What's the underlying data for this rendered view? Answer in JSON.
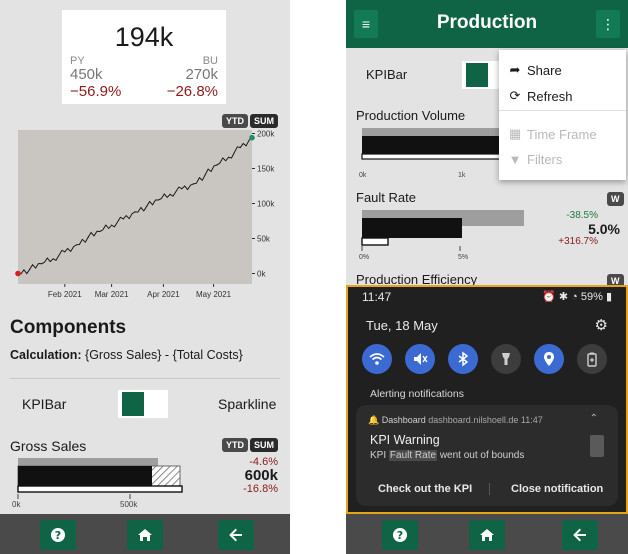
{
  "left_screen": {
    "kpi": {
      "value": "194k",
      "py_label": "PY",
      "bu_label": "BU",
      "py_value": "450k",
      "bu_value": "270k",
      "py_delta": "−56.9%",
      "bu_delta": "−26.8%"
    },
    "toggles": {
      "ytd": "YTD",
      "sum": "SUM"
    },
    "chart_data": {
      "type": "line",
      "x": [
        "2021-01-04",
        "2021-01-11",
        "2021-01-18",
        "2021-01-25",
        "2021-02-01",
        "2021-02-08",
        "2021-02-15",
        "2021-02-22",
        "2021-03-01",
        "2021-03-08",
        "2021-03-15",
        "2021-03-22",
        "2021-03-29",
        "2021-04-05",
        "2021-04-12",
        "2021-04-19",
        "2021-04-26",
        "2021-05-03",
        "2021-05-10",
        "2021-05-17",
        "2021-05-24"
      ],
      "values": [
        0,
        6,
        14,
        21,
        31,
        41,
        52,
        60,
        69,
        78,
        88,
        96,
        105,
        113,
        121,
        128,
        141,
        155,
        166,
        180,
        194
      ],
      "x_ticks": [
        "Feb 2021",
        "Mar 2021",
        "Apr 2021",
        "May 2021"
      ],
      "y_ticks": [
        "200k",
        "150k",
        "100k",
        "50k",
        "0k"
      ],
      "ylim": [
        -15,
        205
      ],
      "start_marker_color": "#d62020",
      "end_marker_color": "#1f8f6a",
      "line_color": "#1a1a1a",
      "background_color": "#c9c6c2"
    },
    "components_title": "Components",
    "calculation_label": "Calculation:",
    "calculation_text": "{Gross Sales} - {Total Costs}",
    "kpibar_label": "KPIBar",
    "sparkline_label": "Sparkline",
    "gross_sales": {
      "label": "Gross Sales",
      "pct_top": "-4.6%",
      "value": "600k",
      "pct_bottom": "-16.8%",
      "axis": [
        "0k",
        "500k"
      ]
    },
    "nav": [
      "help-icon",
      "home-icon",
      "back-icon"
    ]
  },
  "right_screen": {
    "title": "Production",
    "kpibar_label": "KPIBar",
    "menu": {
      "share": "Share",
      "refresh": "Refresh",
      "time_frame": "Time Frame",
      "filters": "Filters"
    },
    "production_volume": {
      "label": "Production Volume",
      "axis": [
        "0k",
        "1k"
      ]
    },
    "fault_rate": {
      "label": "Fault Rate",
      "badge": "W",
      "pct_top": "-38.5%",
      "value": "5.0%",
      "pct_bottom": "+316.7%",
      "axis": [
        "0%",
        "5%"
      ]
    },
    "production_efficiency": {
      "label": "Production Efficiency",
      "badge": "W"
    },
    "shade": {
      "time": "11:47",
      "status_right": "59%",
      "date": "Tue, 18 May",
      "alert_header": "Alerting notifications",
      "notif_app": "Dashboard",
      "notif_source": "dashboard.nilshoell.de",
      "notif_time": "11:47",
      "notif_title": "KPI Warning",
      "notif_body_pre": "KPI",
      "notif_body_hl": "Fault Rate",
      "notif_body_post": "went out of bounds",
      "action_1": "Check out the KPI",
      "action_2": "Close notification"
    },
    "nav": [
      "help-icon",
      "home-icon",
      "back-icon"
    ]
  },
  "colors": {
    "accent_green": "#0f6446",
    "negative_red": "#8b1a1a",
    "positive_green": "#1f7a3a",
    "highlight_border": "#e4a614"
  }
}
